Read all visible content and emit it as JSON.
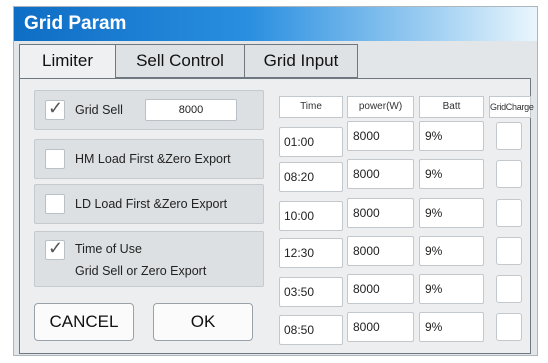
{
  "window": {
    "title": "Grid Param"
  },
  "tabs": [
    {
      "label": "Limiter",
      "active": true
    },
    {
      "label": "Sell Control",
      "active": false
    },
    {
      "label": "Grid Input",
      "active": false
    }
  ],
  "options": {
    "grid_sell": {
      "label": "Grid Sell",
      "checked": true,
      "value": "8000"
    },
    "hm_load": {
      "label": "HM Load First &Zero Export",
      "checked": false
    },
    "ld_load": {
      "label": "LD  Load First &Zero Export",
      "checked": false
    },
    "time_of_use": {
      "label_line1": "Time of Use",
      "label_line2": "Grid Sell or Zero Export",
      "checked": true
    }
  },
  "buttons": {
    "cancel": "CANCEL",
    "ok": "OK"
  },
  "table": {
    "headers": [
      "Time",
      "power(W)",
      "Batt",
      "GridCharge"
    ],
    "rows": [
      {
        "time": "01:00",
        "power": "8000",
        "batt": "9%",
        "grid_charge": false
      },
      {
        "time": "08:20",
        "power": "8000",
        "batt": "9%",
        "grid_charge": false
      },
      {
        "time": "10:00",
        "power": "8000",
        "batt": "9%",
        "grid_charge": false
      },
      {
        "time": "12:30",
        "power": "8000",
        "batt": "9%",
        "grid_charge": false
      },
      {
        "time": "03:50",
        "power": "8000",
        "batt": "9%",
        "grid_charge": false
      },
      {
        "time": "08:50",
        "power": "8000",
        "batt": "9%",
        "grid_charge": false
      }
    ]
  }
}
